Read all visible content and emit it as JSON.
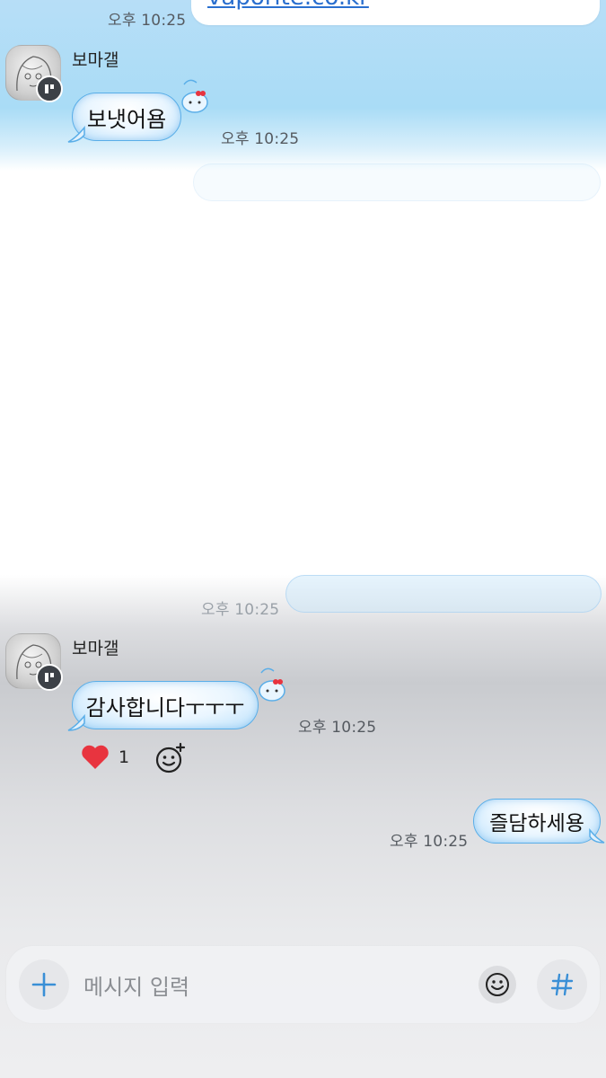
{
  "messages": {
    "top_link": {
      "text": "vaporite.co.kr",
      "time": "오후 10:25"
    },
    "first_group": {
      "sender": "보마갤",
      "text": "보냇어욤",
      "time": "오후 10:25"
    },
    "faded_time": "오후 10:25",
    "second_group": {
      "sender": "보마갤",
      "text": "감사합니다ㅜㅜㅜ",
      "time": "오후 10:25",
      "reaction": {
        "icon": "heart-icon",
        "count": "1",
        "color": "#e8343f"
      }
    },
    "outgoing": {
      "text": "즐담하세용",
      "time": "오후 10:25"
    }
  },
  "input": {
    "placeholder": "메시지 입력",
    "add_icon": "plus-icon",
    "emoji_icon": "smile-icon",
    "hashtag_icon": "hashtag-icon",
    "accent": "#3a8fd6"
  }
}
